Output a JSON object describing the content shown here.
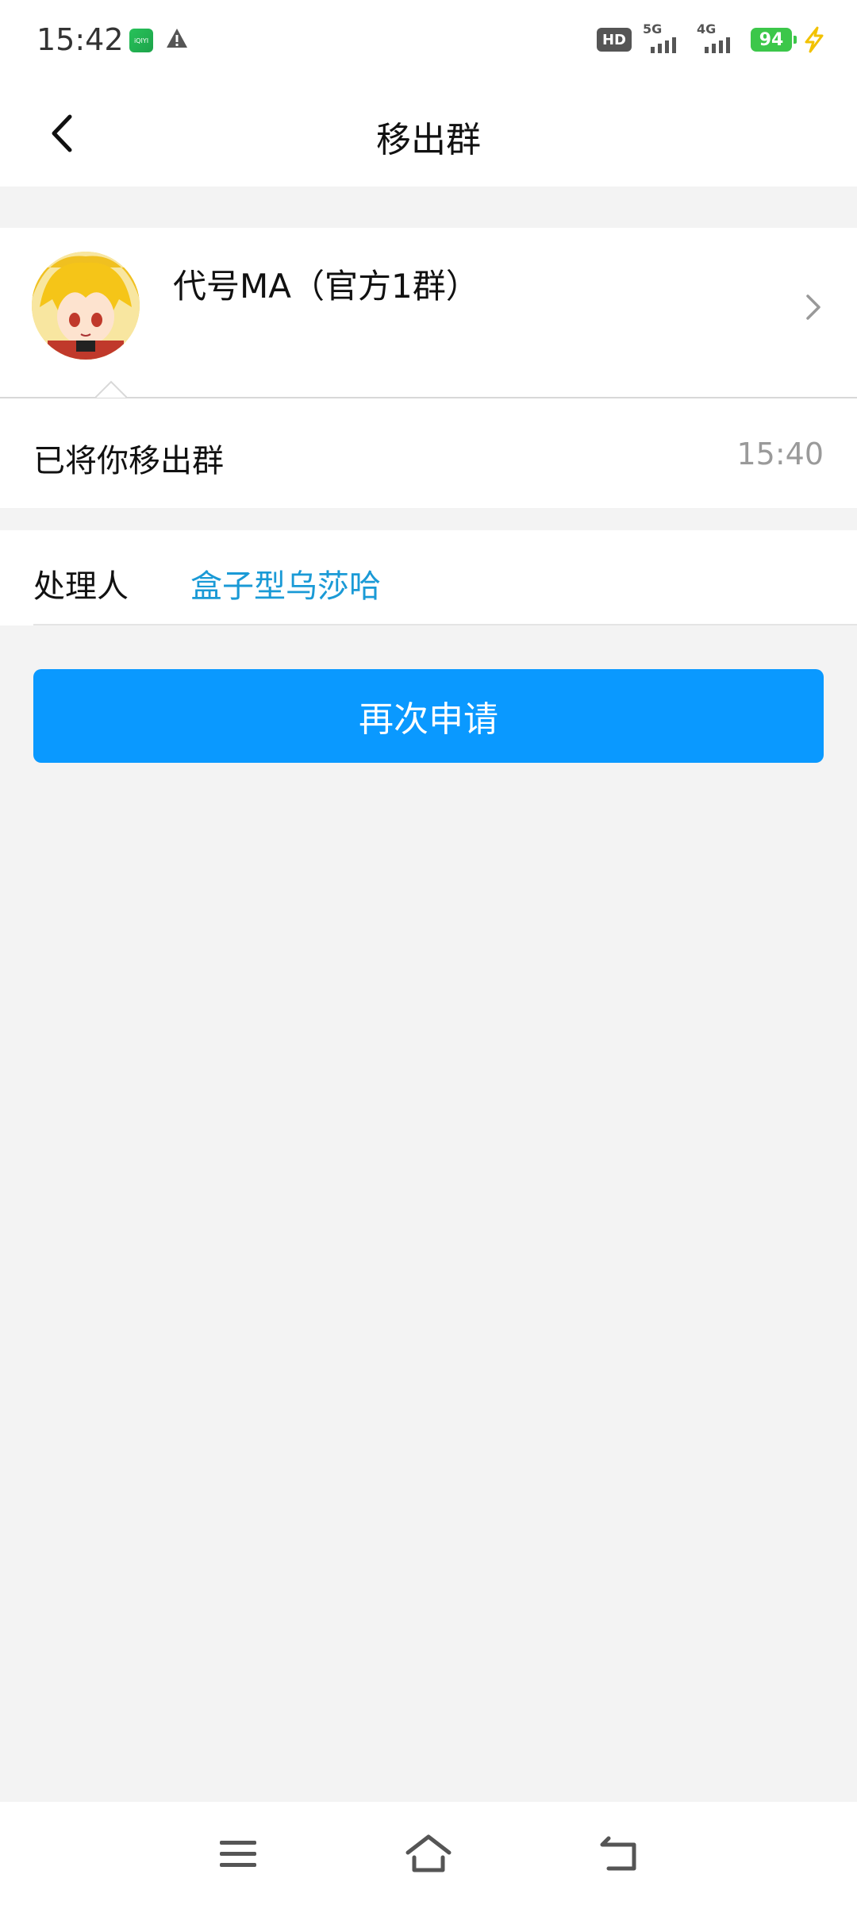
{
  "status_bar": {
    "time": "15:42",
    "battery": "94",
    "network_1": "5G",
    "network_2": "4G",
    "hd_label": "HD"
  },
  "header": {
    "title": "移出群"
  },
  "group": {
    "name": "代号MA（官方1群）"
  },
  "message": {
    "text": "已将你移出群",
    "time": "15:40"
  },
  "handler": {
    "label": "处理人",
    "name": "盒子型乌莎哈"
  },
  "actions": {
    "reapply_label": "再次申请"
  },
  "colors": {
    "accent": "#0a99ff",
    "link": "#1a9ad6",
    "background": "#f3f3f3"
  }
}
